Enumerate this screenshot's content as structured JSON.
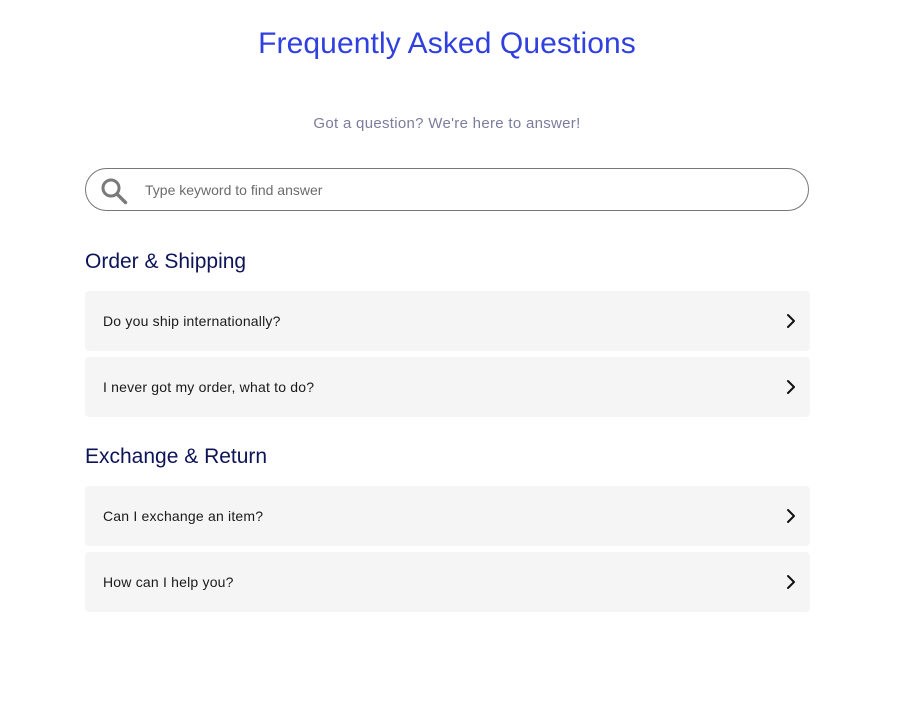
{
  "header": {
    "title": "Frequently Asked Questions",
    "subtitle": "Got a question? We're here to answer!"
  },
  "search": {
    "placeholder": "Type keyword to find answer",
    "value": "",
    "icon": "search-icon"
  },
  "sections": [
    {
      "title": "Order & Shipping",
      "items": [
        {
          "question": "Do you ship internationally?",
          "icon": "chevron-right-icon"
        },
        {
          "question": "I never got my order, what to do?",
          "icon": "chevron-right-icon"
        }
      ]
    },
    {
      "title": "Exchange & Return",
      "items": [
        {
          "question": "Can I exchange an item?",
          "icon": "chevron-right-icon"
        },
        {
          "question": "How can I help you?",
          "icon": "chevron-right-icon"
        }
      ]
    }
  ],
  "colors": {
    "title": "#2f3fe0",
    "subtitle": "#7a7d9c",
    "section_heading": "#0d1457",
    "item_background": "#f5f5f5",
    "search_border": "#777777"
  }
}
